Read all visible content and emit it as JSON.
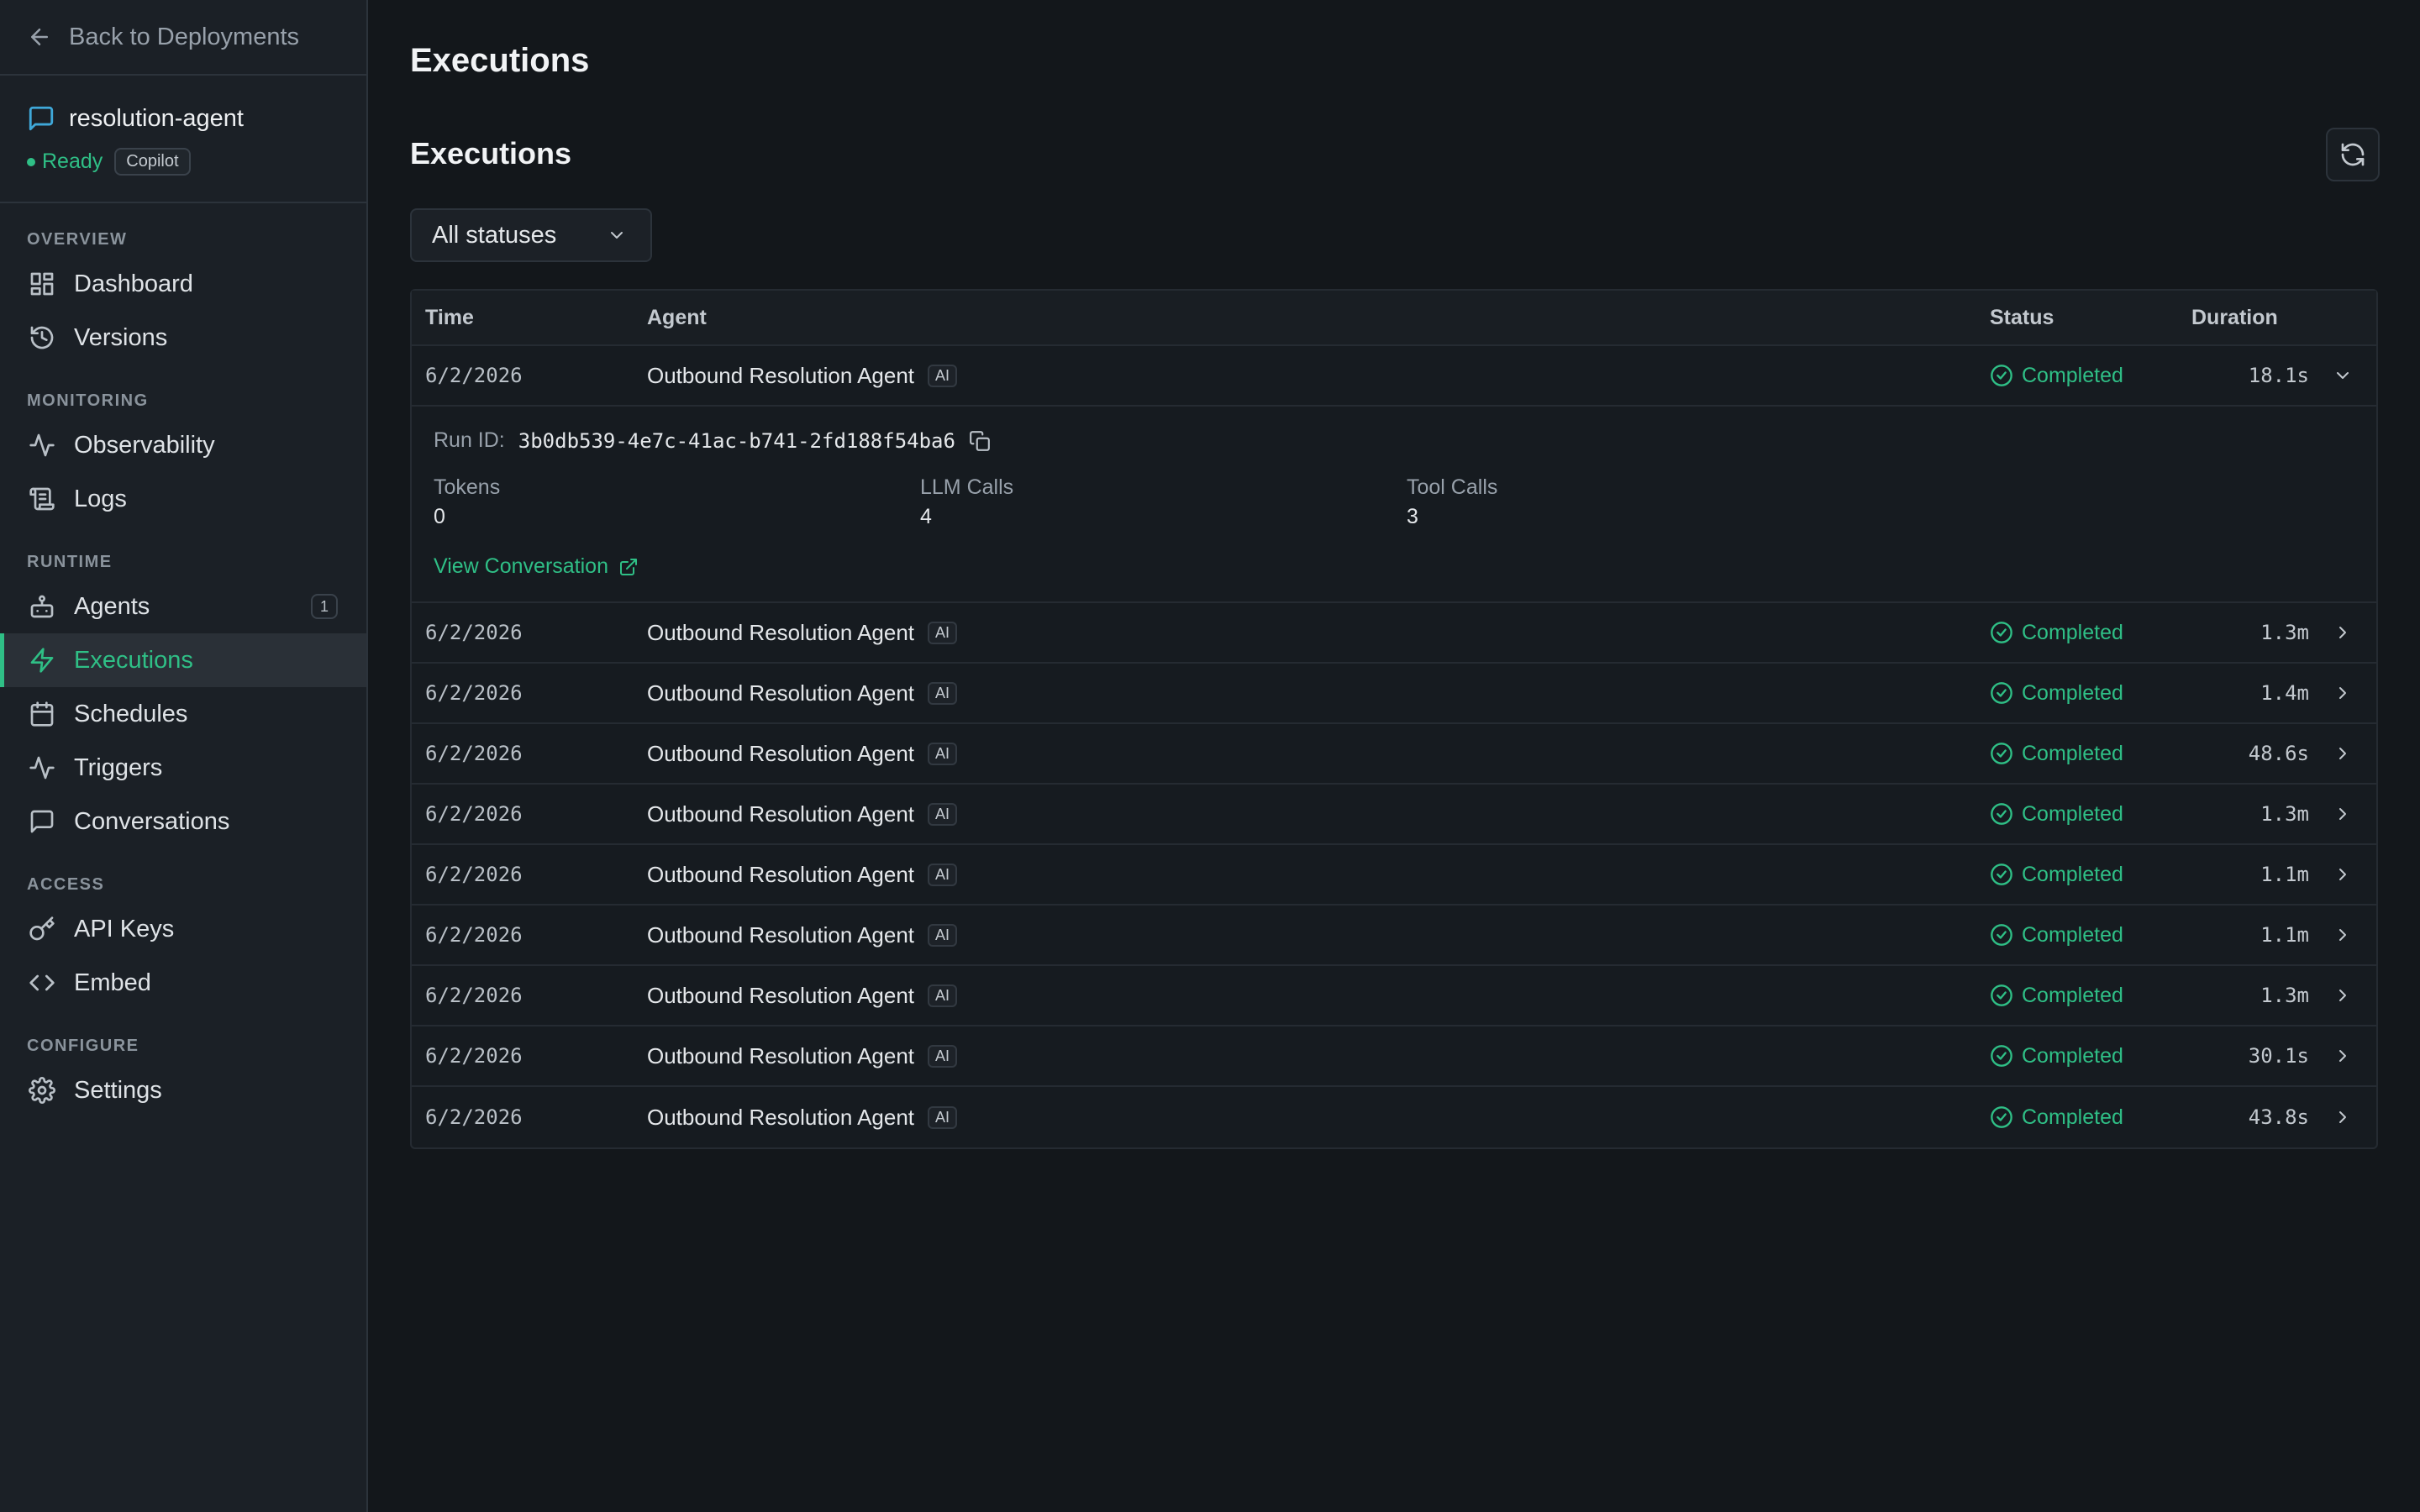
{
  "sidebar": {
    "back_label": "Back to Deployments",
    "project_name": "resolution-agent",
    "status": "Ready",
    "badge": "Copilot",
    "sections": [
      {
        "heading": "OVERVIEW",
        "items": [
          {
            "label": "Dashboard",
            "icon": "dashboard-icon"
          },
          {
            "label": "Versions",
            "icon": "history-icon"
          }
        ]
      },
      {
        "heading": "MONITORING",
        "items": [
          {
            "label": "Observability",
            "icon": "activity-icon"
          },
          {
            "label": "Logs",
            "icon": "scroll-icon"
          }
        ]
      },
      {
        "heading": "RUNTIME",
        "items": [
          {
            "label": "Agents",
            "icon": "bot-icon",
            "count": "1"
          },
          {
            "label": "Executions",
            "icon": "lightning-icon",
            "active": true
          },
          {
            "label": "Schedules",
            "icon": "calendar-icon"
          },
          {
            "label": "Triggers",
            "icon": "activity-icon"
          },
          {
            "label": "Conversations",
            "icon": "message-icon"
          }
        ]
      },
      {
        "heading": "ACCESS",
        "items": [
          {
            "label": "API Keys",
            "icon": "key-icon"
          },
          {
            "label": "Embed",
            "icon": "code-icon"
          }
        ]
      },
      {
        "heading": "CONFIGURE",
        "items": [
          {
            "label": "Settings",
            "icon": "gear-icon"
          }
        ]
      }
    ]
  },
  "main": {
    "page_title": "Executions",
    "section_title": "Executions",
    "filter_value": "All statuses",
    "columns": {
      "time": "Time",
      "agent": "Agent",
      "status": "Status",
      "duration": "Duration"
    },
    "expanded": {
      "run_id_label": "Run ID:",
      "run_id": "3b0db539-4e7c-41ac-b741-2fd188f54ba6",
      "tokens_label": "Tokens",
      "tokens": "0",
      "llm_calls_label": "LLM Calls",
      "llm_calls": "4",
      "tool_calls_label": "Tool Calls",
      "tool_calls": "3",
      "view_conversation": "View Conversation"
    },
    "rows": [
      {
        "time": "6/2/2026",
        "agent": "Outbound Resolution Agent",
        "badge": "AI",
        "status": "Completed",
        "duration": "18.1s"
      },
      {
        "time": "6/2/2026",
        "agent": "Outbound Resolution Agent",
        "badge": "AI",
        "status": "Completed",
        "duration": "1.3m"
      },
      {
        "time": "6/2/2026",
        "agent": "Outbound Resolution Agent",
        "badge": "AI",
        "status": "Completed",
        "duration": "1.4m"
      },
      {
        "time": "6/2/2026",
        "agent": "Outbound Resolution Agent",
        "badge": "AI",
        "status": "Completed",
        "duration": "48.6s"
      },
      {
        "time": "6/2/2026",
        "agent": "Outbound Resolution Agent",
        "badge": "AI",
        "status": "Completed",
        "duration": "1.3m"
      },
      {
        "time": "6/2/2026",
        "agent": "Outbound Resolution Agent",
        "badge": "AI",
        "status": "Completed",
        "duration": "1.1m"
      },
      {
        "time": "6/2/2026",
        "agent": "Outbound Resolution Agent",
        "badge": "AI",
        "status": "Completed",
        "duration": "1.1m"
      },
      {
        "time": "6/2/2026",
        "agent": "Outbound Resolution Agent",
        "badge": "AI",
        "status": "Completed",
        "duration": "1.3m"
      },
      {
        "time": "6/2/2026",
        "agent": "Outbound Resolution Agent",
        "badge": "AI",
        "status": "Completed",
        "duration": "30.1s"
      },
      {
        "time": "6/2/2026",
        "agent": "Outbound Resolution Agent",
        "badge": "AI",
        "status": "Completed",
        "duration": "43.8s"
      }
    ]
  },
  "colors": {
    "accent": "#2fbf86",
    "background": "#13171b",
    "sidebar": "#1b2026",
    "link_icon": "#3fa8d9"
  }
}
